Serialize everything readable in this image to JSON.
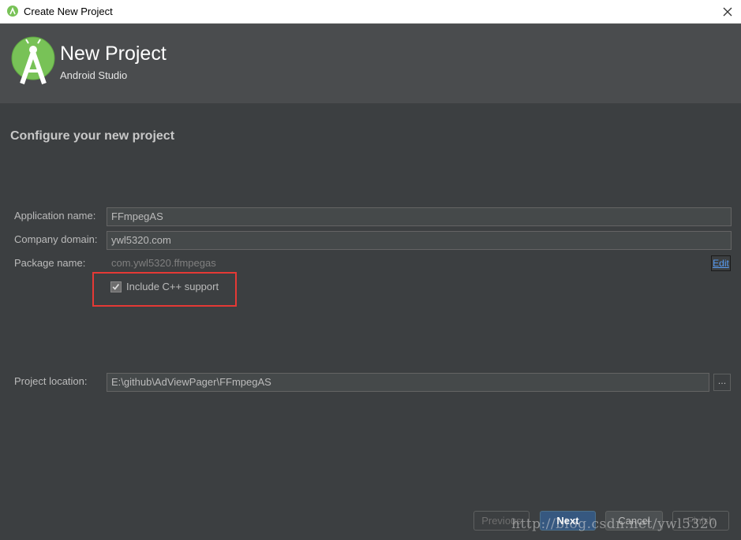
{
  "window": {
    "title": "Create New Project",
    "close_icon": "close-icon",
    "app_icon": "android-studio-icon"
  },
  "banner": {
    "title": "New Project",
    "subtitle": "Android Studio",
    "logo_icon": "android-studio-logo"
  },
  "heading": "Configure your new project",
  "form": {
    "application_name": {
      "label": "Application name:",
      "value": "FFmpegAS"
    },
    "company_domain": {
      "label": "Company domain:",
      "value": "ywl5320.com"
    },
    "package_name": {
      "label": "Package name:",
      "value": "com.ywl5320.ffmpegas",
      "edit_label": "Edit"
    },
    "cpp_support": {
      "label": "Include C++ support",
      "checked": true
    },
    "project_location": {
      "label": "Project location:",
      "value": "E:\\github\\AdViewPager\\FFmpegAS",
      "browse_label": "..."
    }
  },
  "footer": {
    "previous_label": "Previous",
    "next_label": "Next",
    "cancel_label": "Cancel",
    "finish_label": "Finish"
  },
  "watermark": "http://blog.csdn.net/ywl5320",
  "colors": {
    "background": "#3c3f41",
    "banner": "#4a4c4e",
    "highlight_box": "#e53935",
    "link": "#589df6",
    "primary_button": "#365880"
  }
}
